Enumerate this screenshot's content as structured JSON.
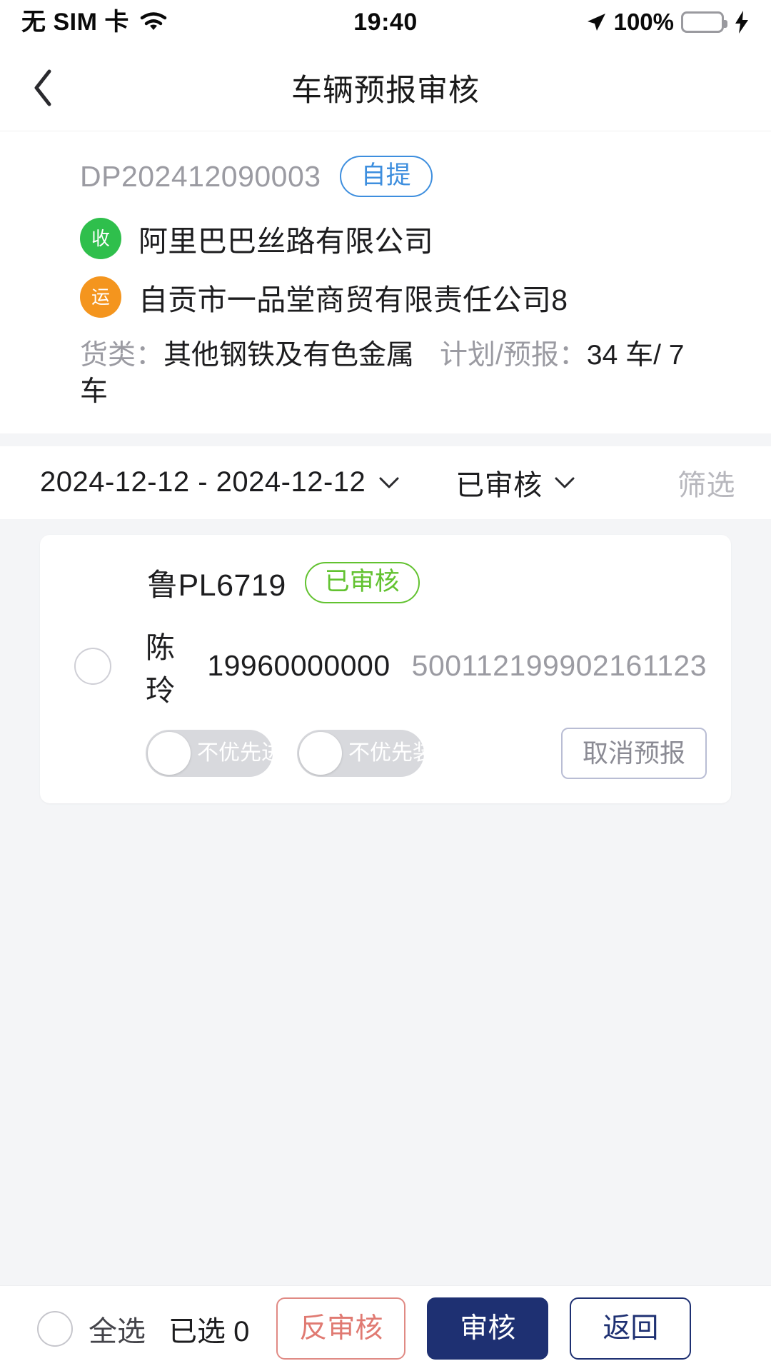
{
  "status_bar": {
    "carrier": "无 SIM 卡",
    "time": "19:40",
    "battery_percent": "100%",
    "wifi_icon": "wifi-icon",
    "location_icon": "location-arrow-icon",
    "battery_icon": "battery-icon",
    "charging_icon": "charging-bolt-icon"
  },
  "nav": {
    "back_icon": "chevron-left-icon",
    "title": "车辆预报审核"
  },
  "order": {
    "order_no": "DP202412090003",
    "delivery_type_badge": "自提",
    "receiver_badge": "收",
    "receiver_name": "阿里巴巴丝路有限公司",
    "shipper_badge": "运",
    "shipper_name": "自贡市一品堂商贸有限责任公司8",
    "cargo_label": "货类：",
    "cargo_value": "其他钢铁及有色金属",
    "plan_label": "计划/预报：",
    "plan_value": "34 车/ 7 车"
  },
  "filter_bar": {
    "date_range": "2024-12-12 - 2024-12-12",
    "date_caret_icon": "chevron-down-icon",
    "status": "已审核",
    "status_caret_icon": "chevron-down-icon",
    "filter_label": "筛选"
  },
  "vehicles": [
    {
      "plate": "鲁PL6719",
      "status_badge": "已审核",
      "selected": false,
      "driver_name": "陈玲",
      "driver_phone": "19960000000",
      "driver_id": "500112199902161123",
      "toggle_entry_label": "不优先进",
      "toggle_entry_on": false,
      "toggle_load_label": "不优先装",
      "toggle_load_on": false,
      "cancel_button": "取消预报"
    }
  ],
  "bottom_bar": {
    "select_all_label": "全选",
    "selected_count_text": "已选 0",
    "unreview_button": "反审核",
    "review_button": "审核",
    "return_button": "返回"
  },
  "colors": {
    "accent_navy": "#1e3072",
    "badge_blue": "#3d8ede",
    "badge_green": "#62c230",
    "receiver_green": "#2fbf4c",
    "shipper_orange": "#f4951e",
    "danger_red": "#e07a72",
    "page_bg": "#f4f5f7"
  }
}
